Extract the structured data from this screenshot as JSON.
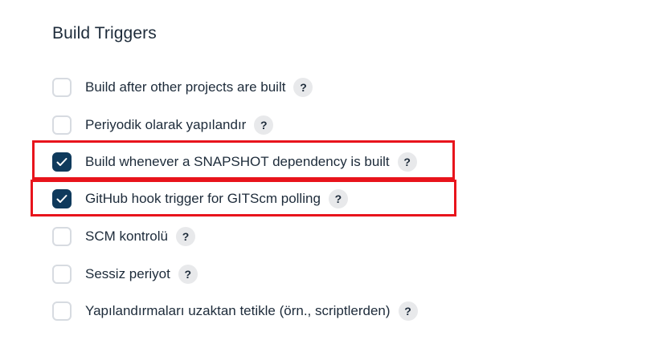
{
  "section": {
    "title": "Build Triggers"
  },
  "triggers": [
    {
      "label": "Build after other projects are built",
      "checked": false,
      "help": "?"
    },
    {
      "label": "Periyodik olarak yapılandır",
      "checked": false,
      "help": "?"
    },
    {
      "label": "Build whenever a SNAPSHOT dependency is built",
      "checked": true,
      "help": "?"
    },
    {
      "label": "GitHub hook trigger for GITScm polling",
      "checked": true,
      "help": "?"
    },
    {
      "label": "SCM kontrolü",
      "checked": false,
      "help": "?"
    },
    {
      "label": "Sessiz periyot",
      "checked": false,
      "help": "?"
    },
    {
      "label": "Yapılandırmaları uzaktan tetikle (örn., scriptlerden)",
      "checked": false,
      "help": "?"
    }
  ],
  "colors": {
    "checkbox_checked": "#0f3a5c",
    "highlight": "#e8141c"
  }
}
